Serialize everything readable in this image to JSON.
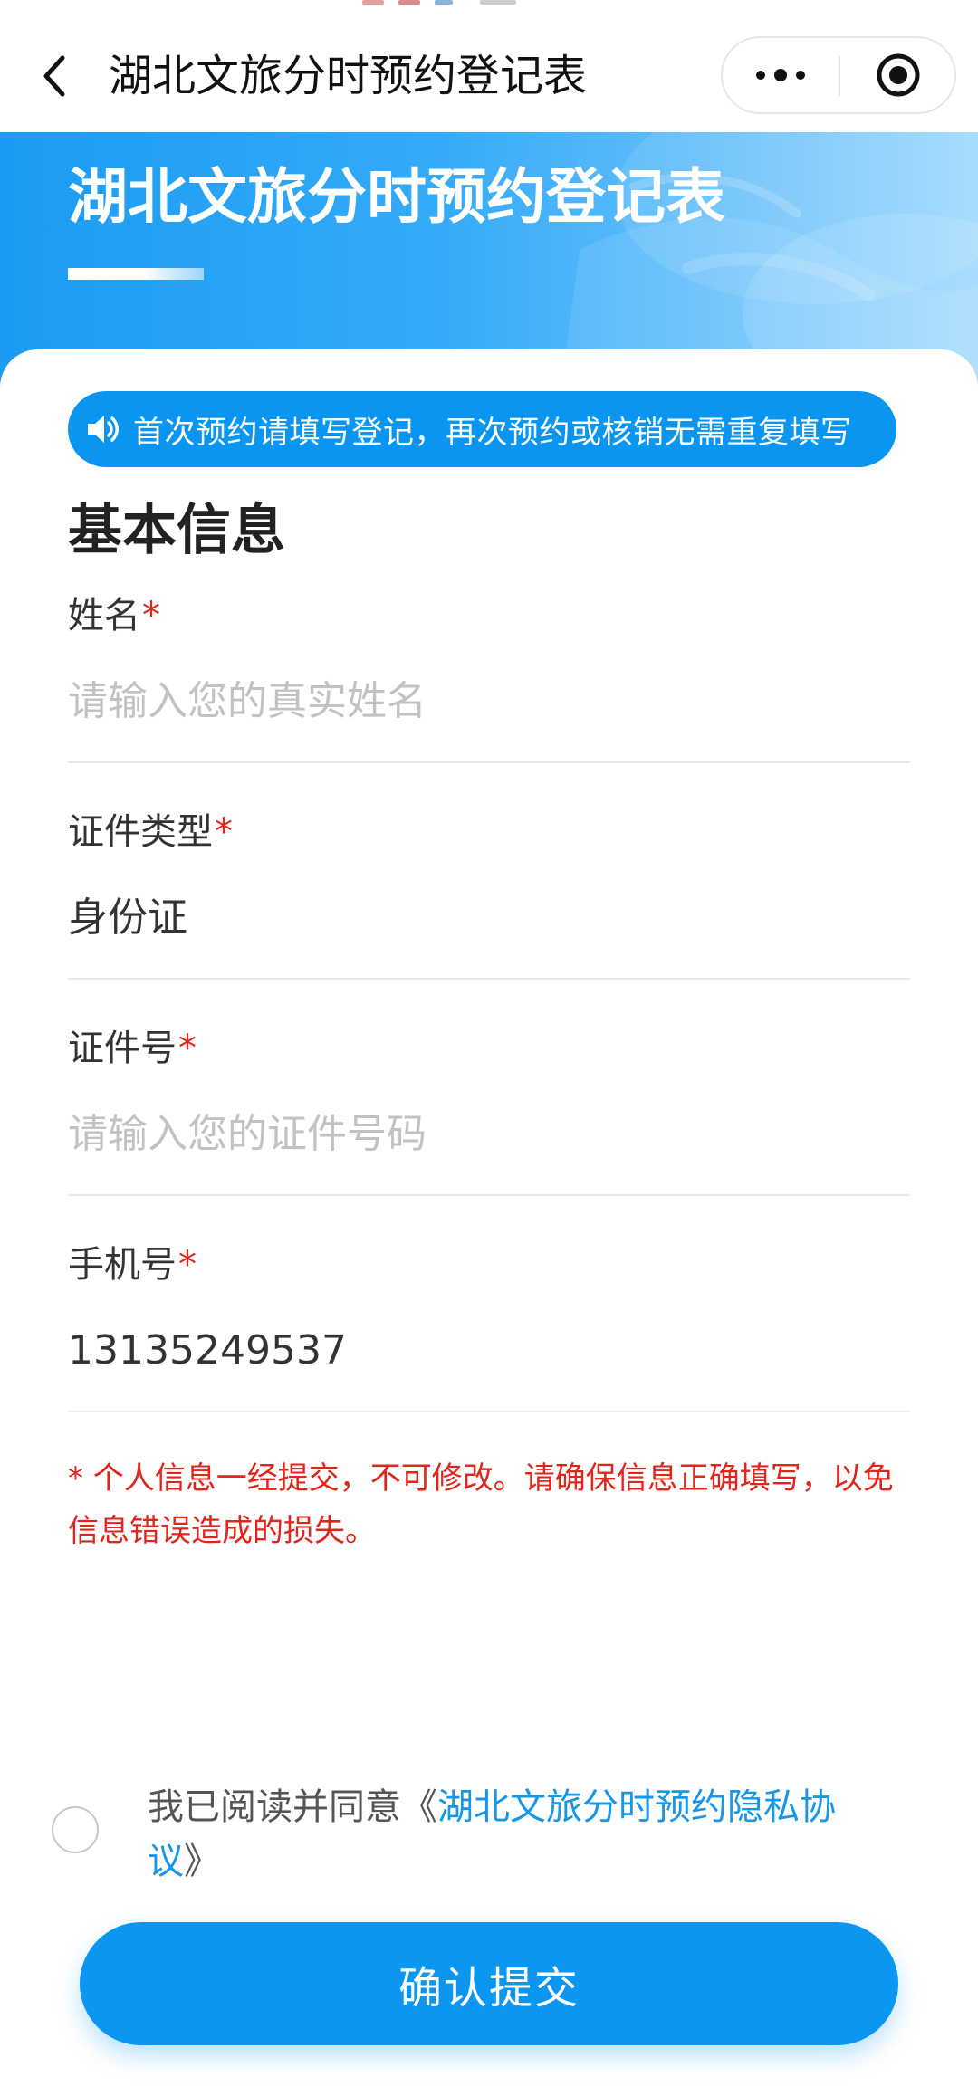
{
  "navbar": {
    "title": "湖北文旅分时预约登记表",
    "back_icon": "chevron-left-icon",
    "more_icon": "more-dots-icon",
    "close_icon": "target-circle-icon"
  },
  "banner": {
    "title": "湖北文旅分时预约登记表"
  },
  "notice": {
    "icon": "speaker-icon",
    "text": "首次预约请填写登记，再次预约或核销无需重复填写"
  },
  "section": {
    "title": "基本信息"
  },
  "form": {
    "fields": [
      {
        "label": "姓名",
        "required_mark": "*",
        "placeholder": "请输入您的真实姓名",
        "value": ""
      },
      {
        "label": "证件类型",
        "required_mark": "*",
        "placeholder": "",
        "value": "身份证"
      },
      {
        "label": "证件号",
        "required_mark": "*",
        "placeholder": "请输入您的证件号码",
        "value": ""
      },
      {
        "label": "手机号",
        "required_mark": "*",
        "placeholder": "",
        "value": "13135249537"
      }
    ],
    "warning": "* 个人信息一经提交，不可修改。请确保信息正确填写，以免信息错误造成的损失。"
  },
  "agreement": {
    "checked": false,
    "prefix": "我已阅读并同意《",
    "link_text": "湖北文旅分时预约隐私协议",
    "suffix": "》"
  },
  "submit": {
    "label": "确认提交"
  },
  "colors": {
    "primary": "#0b96f1",
    "required": "#e0251b",
    "link": "#1896e8",
    "placeholder": "#c2c2c2"
  }
}
